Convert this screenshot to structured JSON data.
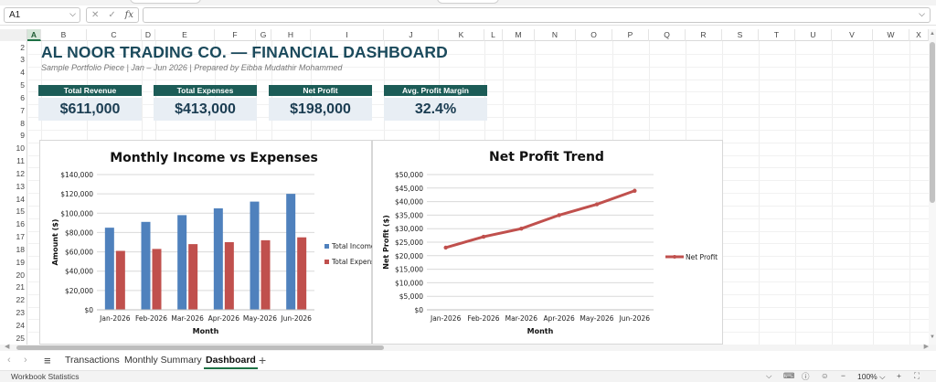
{
  "formula_bar": {
    "cell_ref": "A1",
    "fx_label": "fx",
    "cancel_icon": "close-icon",
    "enter_icon": "check-icon",
    "formula_value": ""
  },
  "columns": [
    "A",
    "B",
    "C",
    "D",
    "E",
    "F",
    "G",
    "H",
    "I",
    "J",
    "K",
    "L",
    "M",
    "N",
    "O",
    "P",
    "Q",
    "R",
    "S",
    "T",
    "U",
    "V",
    "W",
    "X"
  ],
  "selected_column": "A",
  "rows": [
    "2",
    "3",
    "4",
    "5",
    "6",
    "7",
    "8",
    "9",
    "10",
    "11",
    "12",
    "13",
    "14",
    "15",
    "16",
    "17",
    "18",
    "19",
    "20",
    "21",
    "22",
    "23",
    "24",
    "25"
  ],
  "dashboard": {
    "title": "AL NOOR TRADING CO. — FINANCIAL DASHBOARD",
    "subtitle": "Sample Portfolio Piece  |  Jan – Jun 2026  |  Prepared by Eibba Mudathir Mohammed",
    "kpis": [
      {
        "label": "Total Revenue",
        "value": "$611,000"
      },
      {
        "label": "Total Expenses",
        "value": "$413,000"
      },
      {
        "label": "Net Profit",
        "value": "$198,000"
      },
      {
        "label": "Avg. Profit Margin",
        "value": "32.4%"
      }
    ]
  },
  "chart_data": [
    {
      "type": "bar",
      "title": "Monthly Income vs Expenses",
      "xlabel": "Month",
      "ylabel": "Amount ($)",
      "categories": [
        "Jan-2026",
        "Feb-2026",
        "Mar-2026",
        "Apr-2026",
        "May-2026",
        "Jun-2026"
      ],
      "yticks": [
        "$0",
        "$20,000",
        "$40,000",
        "$60,000",
        "$80,000",
        "$100,000",
        "$120,000",
        "$140,000"
      ],
      "ylim": [
        0,
        140000
      ],
      "grid": true,
      "legend_position": "right",
      "series": [
        {
          "name": "Total Income",
          "legend_text": "Total Income",
          "color": "#4f81bd",
          "values": [
            85000,
            91000,
            98000,
            105000,
            112000,
            120000
          ]
        },
        {
          "name": "Total Expenses",
          "legend_text": "Total Expens",
          "color": "#c0504d",
          "values": [
            61000,
            63000,
            68000,
            70000,
            72000,
            75000
          ]
        }
      ]
    },
    {
      "type": "line",
      "title": "Net Profit Trend",
      "xlabel": "Month",
      "ylabel": "Net Profit ($)",
      "categories": [
        "Jan-2026",
        "Feb-2026",
        "Mar-2026",
        "Apr-2026",
        "May-2026",
        "Jun-2026"
      ],
      "yticks": [
        "$0",
        "$5,000",
        "$10,000",
        "$15,000",
        "$20,000",
        "$25,000",
        "$30,000",
        "$35,000",
        "$40,000",
        "$45,000",
        "$50,000"
      ],
      "ylim": [
        0,
        50000
      ],
      "grid": true,
      "legend_position": "right",
      "series": [
        {
          "name": "Net Profit",
          "color": "#c0504d",
          "values": [
            23000,
            27000,
            30000,
            35000,
            39000,
            44000
          ]
        }
      ]
    }
  ],
  "sheet_tabs": {
    "menu_icon": "hamburger-icon",
    "tabs": [
      {
        "label": "Transactions",
        "active": false
      },
      {
        "label": "Monthly Summary",
        "active": false
      },
      {
        "label": "Dashboard",
        "active": true
      }
    ],
    "add_icon": "plus-icon"
  },
  "status_bar": {
    "label": "Workbook Statistics",
    "zoom": "100%"
  },
  "colors": {
    "accent": "#1e7145",
    "kpi_header": "#1c5c57",
    "kpi_value_bg": "#e8eef4",
    "title": "#1b4a5c"
  }
}
